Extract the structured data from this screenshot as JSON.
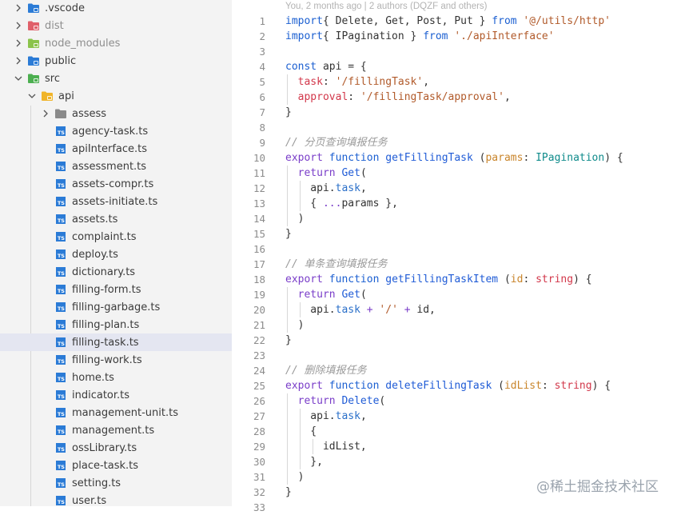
{
  "explorer": {
    "items": [
      {
        "label": ".vscode",
        "icon": "vscode-folder-icon",
        "expanded": false,
        "depth": 0,
        "dim": false,
        "color": "#2b7bd6"
      },
      {
        "label": "dist",
        "icon": "dist-folder-icon",
        "expanded": false,
        "depth": 0,
        "dim": true,
        "color": "#e0606a"
      },
      {
        "label": "node_modules",
        "icon": "node-modules-folder-icon",
        "expanded": false,
        "depth": 0,
        "dim": true,
        "color": "#8bc34a"
      },
      {
        "label": "public",
        "icon": "public-folder-icon",
        "expanded": false,
        "depth": 0,
        "dim": false,
        "color": "#2b7bd6"
      },
      {
        "label": "src",
        "icon": "src-folder-icon",
        "expanded": true,
        "depth": 0,
        "dim": false,
        "color": "#4caf50"
      },
      {
        "label": "api",
        "icon": "api-folder-icon",
        "expanded": true,
        "depth": 1,
        "dim": false,
        "color": "#f0b429"
      },
      {
        "label": "assess",
        "icon": "folder-icon",
        "expanded": false,
        "depth": 2,
        "dim": false,
        "color": "#8a8a8a"
      },
      {
        "label": "agency-task.ts",
        "icon": "typescript-file-icon",
        "depth": 2
      },
      {
        "label": "apiInterface.ts",
        "icon": "typescript-file-icon",
        "depth": 2
      },
      {
        "label": "assessment.ts",
        "icon": "typescript-file-icon",
        "depth": 2
      },
      {
        "label": "assets-compr.ts",
        "icon": "typescript-file-icon",
        "depth": 2
      },
      {
        "label": "assets-initiate.ts",
        "icon": "typescript-file-icon",
        "depth": 2
      },
      {
        "label": "assets.ts",
        "icon": "typescript-file-icon",
        "depth": 2
      },
      {
        "label": "complaint.ts",
        "icon": "typescript-file-icon",
        "depth": 2
      },
      {
        "label": "deploy.ts",
        "icon": "typescript-file-icon",
        "depth": 2
      },
      {
        "label": "dictionary.ts",
        "icon": "typescript-file-icon",
        "depth": 2
      },
      {
        "label": "filling-form.ts",
        "icon": "typescript-file-icon",
        "depth": 2
      },
      {
        "label": "filling-garbage.ts",
        "icon": "typescript-file-icon",
        "depth": 2
      },
      {
        "label": "filling-plan.ts",
        "icon": "typescript-file-icon",
        "depth": 2
      },
      {
        "label": "filling-task.ts",
        "icon": "typescript-file-icon",
        "depth": 2,
        "selected": true
      },
      {
        "label": "filling-work.ts",
        "icon": "typescript-file-icon",
        "depth": 2
      },
      {
        "label": "home.ts",
        "icon": "typescript-file-icon",
        "depth": 2
      },
      {
        "label": "indicator.ts",
        "icon": "typescript-file-icon",
        "depth": 2
      },
      {
        "label": "management-unit.ts",
        "icon": "typescript-file-icon",
        "depth": 2
      },
      {
        "label": "management.ts",
        "icon": "typescript-file-icon",
        "depth": 2
      },
      {
        "label": "ossLibrary.ts",
        "icon": "typescript-file-icon",
        "depth": 2
      },
      {
        "label": "place-task.ts",
        "icon": "typescript-file-icon",
        "depth": 2
      },
      {
        "label": "setting.ts",
        "icon": "typescript-file-icon",
        "depth": 2
      },
      {
        "label": "user.ts",
        "icon": "typescript-file-icon",
        "depth": 2
      }
    ],
    "ts_badge": "TS"
  },
  "editor": {
    "blame": "You, 2 months ago | 2 authors (DQZF and others)",
    "lines": [
      {
        "n": "1",
        "tokens": [
          [
            "kwb",
            "import"
          ],
          [
            "",
            "{ Delete, Get, Post, Put } "
          ],
          [
            "kwb",
            "from"
          ],
          [
            "str",
            " '@/utils/http'"
          ]
        ]
      },
      {
        "n": "2",
        "tokens": [
          [
            "kwb",
            "import"
          ],
          [
            "",
            "{ IPagination } "
          ],
          [
            "kwb",
            "from"
          ],
          [
            "str",
            " './apiInterface'"
          ]
        ]
      },
      {
        "n": "3",
        "tokens": []
      },
      {
        "n": "4",
        "tokens": [
          [
            "kwb",
            "const"
          ],
          [
            "",
            " api = {"
          ]
        ]
      },
      {
        "n": "5",
        "tokens": [
          [
            "",
            " "
          ],
          [
            "prop",
            " task"
          ],
          [
            "",
            ": "
          ],
          [
            "str",
            "'/fillingTask'"
          ],
          [
            "",
            ","
          ]
        ]
      },
      {
        "n": "6",
        "tokens": [
          [
            "",
            " "
          ],
          [
            "prop",
            " approval"
          ],
          [
            "",
            ": "
          ],
          [
            "str",
            "'/fillingTask/approval'"
          ],
          [
            "",
            ","
          ]
        ]
      },
      {
        "n": "7",
        "tokens": [
          [
            "",
            "}"
          ]
        ]
      },
      {
        "n": "8",
        "tokens": []
      },
      {
        "n": "9",
        "tokens": [
          [
            "cmt",
            "// 分页查询填报任务"
          ]
        ]
      },
      {
        "n": "10",
        "tokens": [
          [
            "kw",
            "export"
          ],
          [
            "kwb",
            " function"
          ],
          [
            "fn",
            " getFillingTask"
          ],
          [
            "",
            " ("
          ],
          [
            "param",
            "params"
          ],
          [
            "",
            ": "
          ],
          [
            "type",
            "IPagination"
          ],
          [
            "",
            ") {"
          ]
        ]
      },
      {
        "n": "11",
        "tokens": [
          [
            "",
            " "
          ],
          [
            "kw",
            " return"
          ],
          [
            "fn",
            " Get"
          ],
          [
            "",
            "("
          ]
        ]
      },
      {
        "n": "12",
        "tokens": [
          [
            "",
            "    api."
          ],
          [
            "var",
            "task"
          ],
          [
            "",
            ","
          ]
        ]
      },
      {
        "n": "13",
        "tokens": [
          [
            "",
            "    { "
          ],
          [
            "op",
            "..."
          ],
          [
            "",
            "params },"
          ]
        ]
      },
      {
        "n": "14",
        "tokens": [
          [
            "",
            "  )"
          ]
        ]
      },
      {
        "n": "15",
        "tokens": [
          [
            "",
            "}"
          ]
        ]
      },
      {
        "n": "16",
        "tokens": []
      },
      {
        "n": "17",
        "tokens": [
          [
            "cmt",
            "// 单条查询填报任务"
          ]
        ]
      },
      {
        "n": "18",
        "tokens": [
          [
            "kw",
            "export"
          ],
          [
            "kwb",
            " function"
          ],
          [
            "fn",
            " getFillingTaskItem"
          ],
          [
            "",
            " ("
          ],
          [
            "param",
            "id"
          ],
          [
            "",
            ": "
          ],
          [
            "prop",
            "string"
          ],
          [
            "",
            ") {"
          ]
        ]
      },
      {
        "n": "19",
        "tokens": [
          [
            "",
            " "
          ],
          [
            "kw",
            " return"
          ],
          [
            "fn",
            " Get"
          ],
          [
            "",
            "("
          ]
        ]
      },
      {
        "n": "20",
        "tokens": [
          [
            "",
            "    api."
          ],
          [
            "var",
            "task"
          ],
          [
            "op",
            " +"
          ],
          [
            "str",
            " '/'"
          ],
          [
            "op",
            " +"
          ],
          [
            "",
            " id,"
          ]
        ]
      },
      {
        "n": "21",
        "tokens": [
          [
            "",
            "  )"
          ]
        ]
      },
      {
        "n": "22",
        "tokens": [
          [
            "",
            "}"
          ]
        ]
      },
      {
        "n": "23",
        "tokens": []
      },
      {
        "n": "24",
        "tokens": [
          [
            "cmt",
            "// 删除填报任务"
          ]
        ]
      },
      {
        "n": "25",
        "tokens": [
          [
            "kw",
            "export"
          ],
          [
            "kwb",
            " function"
          ],
          [
            "fn",
            " deleteFillingTask"
          ],
          [
            "",
            " ("
          ],
          [
            "param",
            "idList"
          ],
          [
            "",
            ": "
          ],
          [
            "prop",
            "string"
          ],
          [
            "",
            ") {"
          ]
        ]
      },
      {
        "n": "26",
        "tokens": [
          [
            "",
            " "
          ],
          [
            "kw",
            " return"
          ],
          [
            "fn",
            " Delete"
          ],
          [
            "",
            "("
          ]
        ]
      },
      {
        "n": "27",
        "tokens": [
          [
            "",
            "    api."
          ],
          [
            "var",
            "task"
          ],
          [
            "",
            ","
          ]
        ]
      },
      {
        "n": "28",
        "tokens": [
          [
            "",
            "    {"
          ]
        ]
      },
      {
        "n": "29",
        "tokens": [
          [
            "",
            "      idList,"
          ]
        ]
      },
      {
        "n": "30",
        "tokens": [
          [
            "",
            "    },"
          ]
        ]
      },
      {
        "n": "31",
        "tokens": [
          [
            "",
            "  )"
          ]
        ]
      },
      {
        "n": "32",
        "tokens": [
          [
            "",
            "}"
          ]
        ]
      },
      {
        "n": "33",
        "tokens": []
      }
    ]
  },
  "watermark": "@稀土掘金技术社区",
  "colors": {
    "ts_badge": "#2b7bd6",
    "selected_row": "#e4e6f1"
  }
}
